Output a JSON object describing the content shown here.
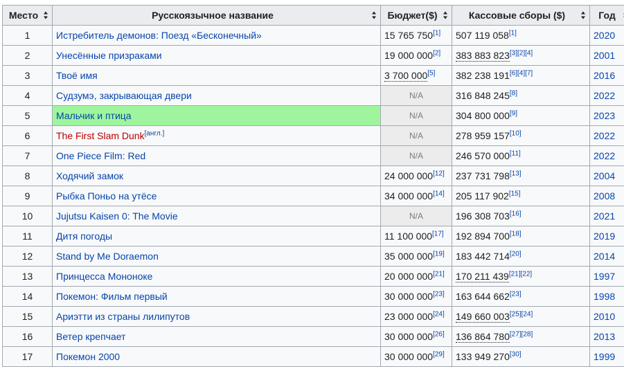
{
  "headers": {
    "rank": "Место",
    "title": "Русскоязычное название",
    "budget": "Бюджет($)",
    "gross": "Кассовые сборы ($)",
    "year": "Год"
  },
  "rows": [
    {
      "rank": "1",
      "title": "Истребитель демонов: Поезд «Бесконечный»",
      "title_sup": "",
      "budget": "15 765 750",
      "budget_ref": "[1]",
      "gross": "507 119 058",
      "gross_ref": "[1]",
      "year": "2020"
    },
    {
      "rank": "2",
      "title": "Унесённые призраками",
      "title_sup": "",
      "budget": "19 000 000",
      "budget_ref": "[2]",
      "gross": "383 883 823",
      "gross_ref": "[3][2][4]",
      "year": "2001"
    },
    {
      "rank": "3",
      "title": "Твоё имя",
      "title_sup": "",
      "budget": "3 700 000",
      "budget_ref": "[5]",
      "gross": "382 238 191",
      "gross_ref": "[6][4][7]",
      "year": "2016"
    },
    {
      "rank": "4",
      "title": "Судзумэ, закрывающая двери",
      "title_sup": "",
      "budget": "N/A",
      "budget_ref": "",
      "gross": "316 848 245",
      "gross_ref": "[8]",
      "year": "2022"
    },
    {
      "rank": "5",
      "title": "Мальчик и птица",
      "title_sup": "",
      "budget": "N/A",
      "budget_ref": "",
      "gross": "304 800 000",
      "gross_ref": "[9]",
      "year": "2023"
    },
    {
      "rank": "6",
      "title": "The First Slam Dunk",
      "title_sup": "[англ.]",
      "budget": "N/A",
      "budget_ref": "",
      "gross": "278 959 157",
      "gross_ref": "[10]",
      "year": "2022"
    },
    {
      "rank": "7",
      "title": "One Piece Film: Red",
      "title_sup": "",
      "budget": "N/A",
      "budget_ref": "",
      "gross": "246 570 000",
      "gross_ref": "[11]",
      "year": "2022"
    },
    {
      "rank": "8",
      "title": "Ходячий замок",
      "title_sup": "",
      "budget": "24 000 000",
      "budget_ref": "[12]",
      "gross": "237 731 798",
      "gross_ref": "[13]",
      "year": "2004"
    },
    {
      "rank": "9",
      "title": "Рыбка Поньо на утёсе",
      "title_sup": "",
      "budget": "34 000 000",
      "budget_ref": "[14]",
      "gross": "205 117 902",
      "gross_ref": "[15]",
      "year": "2008"
    },
    {
      "rank": "10",
      "title": "Jujutsu Kaisen 0: The Movie",
      "title_sup": "",
      "budget": "N/A",
      "budget_ref": "",
      "gross": "196 308 703",
      "gross_ref": "[16]",
      "year": "2021"
    },
    {
      "rank": "11",
      "title": "Дитя погоды",
      "title_sup": "",
      "budget": "11 100 000",
      "budget_ref": "[17]",
      "gross": "192 894 700",
      "gross_ref": "[18]",
      "year": "2019"
    },
    {
      "rank": "12",
      "title": "Stand by Me Doraemon",
      "title_sup": "",
      "budget": "35 000 000",
      "budget_ref": "[19]",
      "gross": "183 442 714",
      "gross_ref": "[20]",
      "year": "2014"
    },
    {
      "rank": "13",
      "title": "Принцесса Мононоке",
      "title_sup": "",
      "budget": "20 000 000",
      "budget_ref": "[21]",
      "gross": "170 211 439",
      "gross_ref": "[21][22]",
      "year": "1997"
    },
    {
      "rank": "14",
      "title": "Покемон: Фильм первый",
      "title_sup": "",
      "budget": "30 000 000",
      "budget_ref": "[23]",
      "gross": "163 644 662",
      "gross_ref": "[23]",
      "year": "1998"
    },
    {
      "rank": "15",
      "title": "Ариэтти из страны лилипутов",
      "title_sup": "",
      "budget": "23 000 000",
      "budget_ref": "[24]",
      "gross": "149 660 003",
      "gross_ref": "[25][24]",
      "year": "2010"
    },
    {
      "rank": "16",
      "title": "Ветер крепчает",
      "title_sup": "",
      "budget": "30 000 000",
      "budget_ref": "[26]",
      "gross": "136 864 780",
      "gross_ref": "[27][28]",
      "year": "2013"
    },
    {
      "rank": "17",
      "title": "Покемон 2000",
      "title_sup": "",
      "budget": "30 000 000",
      "budget_ref": "[29]",
      "gross": "133 949 270",
      "gross_ref": "[30]",
      "year": "1999"
    }
  ],
  "colors": {
    "link": "#0645ad",
    "redlink": "#ba0000",
    "highlight": "#9ef59e",
    "na_bg": "#ececec",
    "header_bg": "#eaecf0"
  }
}
